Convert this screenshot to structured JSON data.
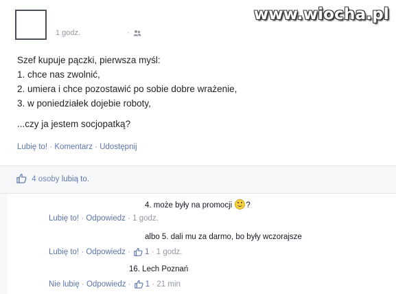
{
  "watermark": "www.wiocha.pl",
  "post": {
    "time": "1 godz.",
    "audience_sep": "·",
    "audience_icon": "people-icon",
    "lines": [
      "Szef kupuje pączki, pierwsza myśl:",
      "1. chce nas zwolnić,",
      "2. umiera i chce pozostawić po sobie dobre wrażenie,",
      "3. w poniedziałek dojebie roboty,"
    ],
    "closing": "...czy ja jestem socjopatką?",
    "actions": {
      "like": "Lubię to!",
      "comment": "Komentarz",
      "share": "Udostępnij",
      "sep": "·"
    }
  },
  "likes": {
    "icon": "thumbs-up-icon",
    "count_text": "4 osoby",
    "suffix": "lubią to."
  },
  "comments": [
    {
      "text": "4. może były na promocji",
      "after_emoji": "?",
      "emoji": "smiley-icon",
      "action_like": "Lubię to!",
      "action_reply": "Odpowiedz",
      "time": "1 godz."
    },
    {
      "text": "albo 5. dali mu za darmo, bo były wczorajsze",
      "action_like": "Lubię to!",
      "action_reply": "Odpowiedz",
      "like_count": "1",
      "time": "1 godz."
    },
    {
      "text": "16. Lech Poznań",
      "action_like": "Nie lubię",
      "action_reply": "Odpowiedz",
      "like_count": "1",
      "time": "21 min"
    }
  ],
  "colors": {
    "link": "#5b74a8",
    "muted": "#9197a3",
    "ufi_bg": "#f6f7f9"
  }
}
